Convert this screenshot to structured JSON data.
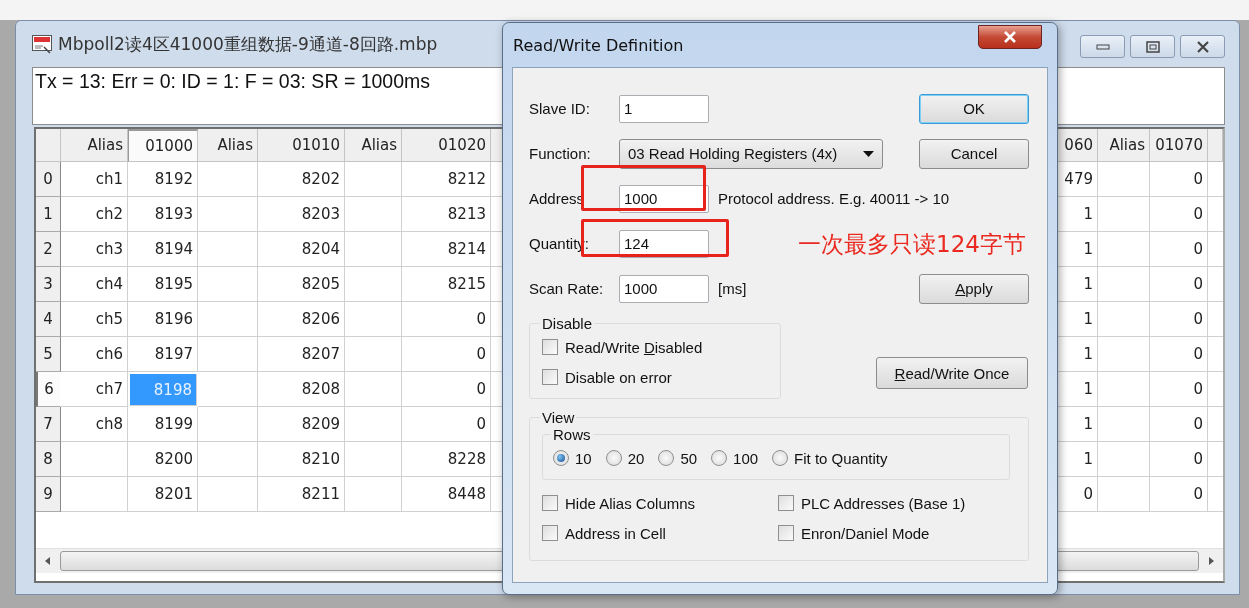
{
  "main_window": {
    "title": "Mbpoll2读4区41000重组数据-9通道-8回路.mbp",
    "status": "Tx = 13: Err = 0: ID = 1: F = 03: SR = 1000ms"
  },
  "table_left": {
    "columns": [
      {
        "label": "Alias",
        "selected": false
      },
      {
        "label": "01000",
        "selected": true
      },
      {
        "label": "Alias",
        "selected": false
      },
      {
        "label": "01010",
        "selected": false
      },
      {
        "label": "Alias",
        "selected": false
      },
      {
        "label": "01020",
        "selected": false
      }
    ],
    "rows": [
      {
        "header": "0",
        "selected": false,
        "cells": [
          "ch1",
          "8192",
          "",
          "8202",
          "",
          "8212"
        ]
      },
      {
        "header": "1",
        "selected": false,
        "cells": [
          "ch2",
          "8193",
          "",
          "8203",
          "",
          "8213"
        ]
      },
      {
        "header": "2",
        "selected": false,
        "cells": [
          "ch3",
          "8194",
          "",
          "8204",
          "",
          "8214"
        ]
      },
      {
        "header": "3",
        "selected": false,
        "cells": [
          "ch4",
          "8195",
          "",
          "8205",
          "",
          "8215"
        ]
      },
      {
        "header": "4",
        "selected": false,
        "cells": [
          "ch5",
          "8196",
          "",
          "8206",
          "",
          "0"
        ]
      },
      {
        "header": "5",
        "selected": false,
        "cells": [
          "ch6",
          "8197",
          "",
          "8207",
          "",
          "0"
        ]
      },
      {
        "header": "6",
        "selected": true,
        "cells": [
          "ch7",
          "8198",
          "",
          "8208",
          "",
          "0"
        ]
      },
      {
        "header": "7",
        "selected": false,
        "cells": [
          "ch8",
          "8199",
          "",
          "8209",
          "",
          "0"
        ]
      },
      {
        "header": "8",
        "selected": false,
        "cells": [
          "",
          "8200",
          "",
          "8210",
          "",
          "8228"
        ]
      },
      {
        "header": "9",
        "selected": false,
        "cells": [
          "",
          "8201",
          "",
          "8211",
          "",
          "8448"
        ]
      }
    ]
  },
  "table_right": {
    "columns": [
      "060",
      "Alias",
      "01070"
    ],
    "rows": [
      [
        "479",
        "",
        "0"
      ],
      [
        "1",
        "",
        "0"
      ],
      [
        "1",
        "",
        "0"
      ],
      [
        "1",
        "",
        "0"
      ],
      [
        "1",
        "",
        "0"
      ],
      [
        "1",
        "",
        "0"
      ],
      [
        "1",
        "",
        "0"
      ],
      [
        "1",
        "",
        "0"
      ],
      [
        "1",
        "",
        "0"
      ],
      [
        "0",
        "",
        "0"
      ]
    ]
  },
  "dialog": {
    "title": "Read/Write Definition",
    "slave_id": {
      "label": "Slave ID:",
      "value": "1"
    },
    "function": {
      "label": "Function:",
      "value": "03 Read Holding Registers (4x)"
    },
    "address": {
      "label": "Address",
      "value": "1000",
      "hint": "Protocol address. E.g. 40011 -> 10"
    },
    "quantity": {
      "label": "Quantity:",
      "value": "124"
    },
    "scan_rate": {
      "label": "Scan Rate:",
      "value": "1000",
      "unit": "[ms]"
    },
    "buttons": [
      {
        "kind": "default",
        "after": "OK"
      },
      {
        "kind": "normal",
        "after": "Cancel"
      },
      {
        "kind": "normal",
        "accel": "A",
        "after": "pply"
      }
    ],
    "once_button": {
      "accel": "R",
      "after": "ead/Write Once"
    },
    "disable_group": {
      "legend": "Disable",
      "options": [
        {
          "before": "Read/Write ",
          "accel": "D",
          "after": "isabled",
          "checked": false
        },
        {
          "before": "Disable on error",
          "checked": false
        }
      ]
    },
    "view_group": {
      "legend": "View",
      "rows_legend": "Rows",
      "rows_options": [
        {
          "label": "10",
          "selected": true
        },
        {
          "label": "20",
          "selected": false
        },
        {
          "label": "50",
          "selected": false
        },
        {
          "label": "100",
          "selected": false
        },
        {
          "label": "Fit to Quantity",
          "selected": false
        }
      ],
      "options": [
        {
          "label": "Hide Alias Columns",
          "checked": false
        },
        {
          "label": "PLC Addresses (Base 1)",
          "checked": false
        },
        {
          "label": "Address in Cell",
          "checked": false
        },
        {
          "label": "Enron/Daniel Mode",
          "checked": false
        }
      ]
    }
  },
  "annotation": {
    "text": "一次最多只读124字节"
  }
}
